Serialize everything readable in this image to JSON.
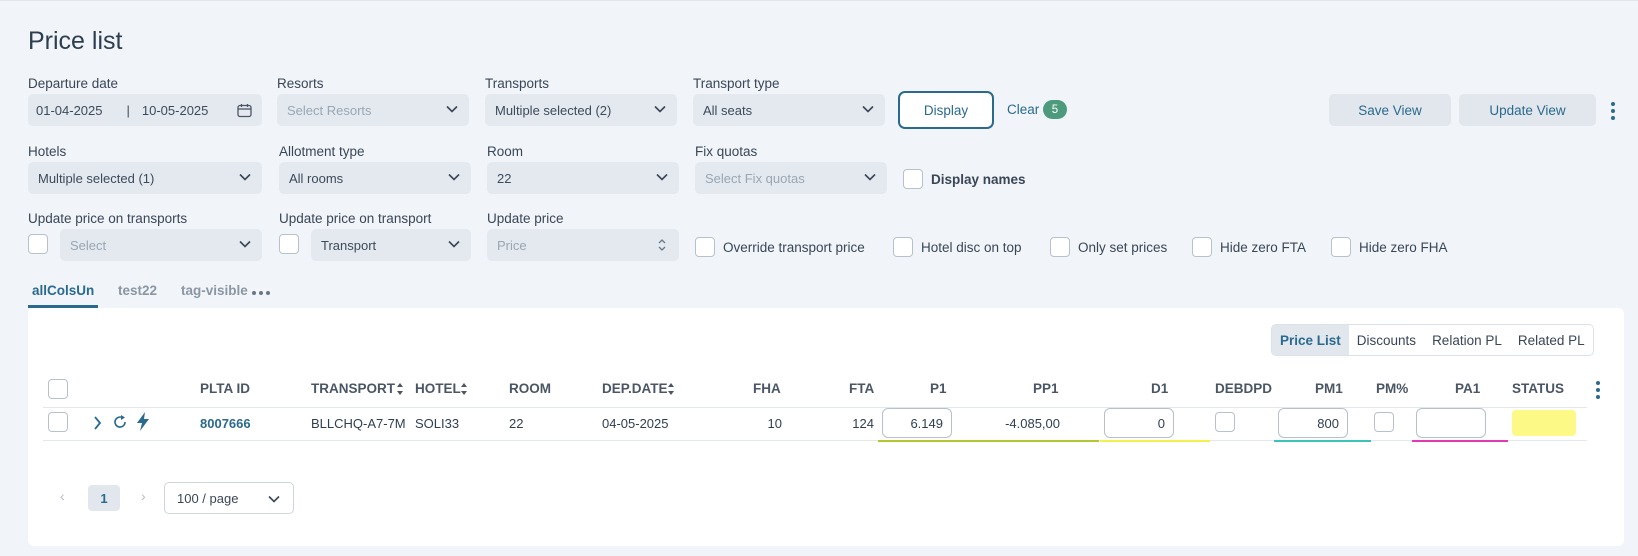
{
  "page": {
    "title": "Price list"
  },
  "filters": {
    "departure_date": {
      "label": "Departure date",
      "from": "01-04-2025",
      "sep": "|",
      "to": "10-05-2025"
    },
    "resorts": {
      "label": "Resorts",
      "placeholder": "Select Resorts"
    },
    "transports": {
      "label": "Transports",
      "value": "Multiple selected (2)"
    },
    "transport_type": {
      "label": "Transport type",
      "value": "All seats"
    },
    "hotels": {
      "label": "Hotels",
      "value": "Multiple selected (1)"
    },
    "allotment_type": {
      "label": "Allotment type",
      "value": "All rooms"
    },
    "room": {
      "label": "Room",
      "value": "22"
    },
    "fix_quotas": {
      "label": "Fix quotas",
      "placeholder": "Select Fix quotas"
    },
    "display_names": "Display names",
    "update_price_on_transports": {
      "label": "Update price on transports",
      "placeholder": "Select"
    },
    "update_price_on_transport": {
      "label": "Update price on transport",
      "value": "Transport"
    },
    "update_price": {
      "label": "Update price",
      "placeholder": "Price"
    },
    "checkboxes": [
      "Override transport price",
      "Hotel disc on top",
      "Only set prices",
      "Hide zero FTA",
      "Hide zero FHA"
    ]
  },
  "actions": {
    "display": "Display",
    "clear": "Clear",
    "clear_count": "5",
    "save_view": "Save View",
    "update_view": "Update View"
  },
  "tabs": [
    "allColsUn",
    "test22",
    "tag-visible"
  ],
  "segments": [
    "Price List",
    "Discounts",
    "Relation PL",
    "Related PL"
  ],
  "table": {
    "headers": [
      "PLTA ID",
      "TRANSPORT",
      "HOTEL",
      "ROOM",
      "DEP.DATE",
      "FHA",
      "FTA",
      "P1",
      "PP1",
      "D1",
      "DEBDPD",
      "PM1",
      "PM%",
      "PA1",
      "STATUS"
    ],
    "row": {
      "plta_id": "8007666",
      "transport": "BLLCHQ-A7-7M",
      "hotel": "SOLI33",
      "room": "22",
      "dep_date": "04-05-2025",
      "fha": "10",
      "fta": "124",
      "p1": "6.149",
      "pp1": "-4.085,00",
      "d1": "0",
      "pm1": "800"
    }
  },
  "pagination": {
    "page": "1",
    "per_page": "100 / page",
    "prev": "‹",
    "next": "›"
  },
  "colors": {
    "accent": "#2a6a8e",
    "badge": "#4e9a7c",
    "status": "#fdf986",
    "underline_p1": "#b5c730",
    "underline_d1": "#f2f24a",
    "underline_pm1": "#3cc3b7",
    "underline_pa1": "#e33ab3"
  }
}
